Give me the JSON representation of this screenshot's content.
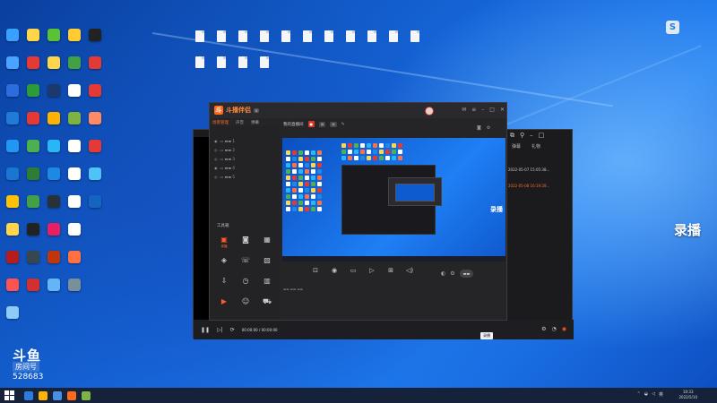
{
  "desktop": {
    "icon_colors": [
      "#3aa0ff",
      "#ffd54a",
      "#5bc236",
      "#ffcc33",
      "#222",
      "#fff",
      "#4aa3ff",
      "#e53935",
      "#ffd54a",
      "#43a047",
      "#e53935",
      "#fff",
      "#2d6cdf",
      "#2c9b3a",
      "#1b3a6b",
      "#fff",
      "#e53935",
      "#fff",
      "#1f7bd8",
      "#e53935",
      "#ffb300",
      "#7cb342",
      "#ff8a65",
      "#fff",
      "#2196f3",
      "#4caf50",
      "#29b6f6",
      "#fff",
      "#e53935",
      "#fff",
      "#1976d2",
      "#2e7d32",
      "#1e88e5",
      "#fff",
      "#4fc3f7",
      "#fff",
      "#ffc107",
      "#43a047",
      "#263238",
      "#fff",
      "#1565c0",
      "#fff",
      "#ffd54a",
      "#222",
      "#e91e63",
      "#fff",
      "#fff",
      "#fff",
      "#b71c1c",
      "#37474f",
      "#bf360c",
      "#ff7043",
      "#fff",
      "#fff",
      "#ff5252",
      "#d32f2f",
      "#64b5f6",
      "#78909c",
      "#fff",
      "#fff",
      "#90caf9",
      "#fff",
      "#fff",
      "#fff",
      "#fff",
      "#fff"
    ]
  },
  "recorder": {
    "brand": "斗播伴侣",
    "tab_active": "场景管理",
    "tab_sources": "声音",
    "tab_more": "弹幕",
    "stream_title": "我的直播间",
    "toolbox_title": "工具箱",
    "record_label": "录播"
  },
  "overlay": {
    "record_big": "录播",
    "douyu_logo": "斗鱼",
    "douyu_sub": "房间号",
    "room_number": "528683"
  },
  "back_window": {
    "time": "00:00:00 / 00:00:00",
    "tab1": "弹幕",
    "tab2": "礼物",
    "line1": "2022-05-07 15:05:38...",
    "line2": "2022-05-08 16:19:28...",
    "tooltip": "录播"
  },
  "taskbar": {
    "time": "10:33",
    "date": "2022/5/10"
  }
}
